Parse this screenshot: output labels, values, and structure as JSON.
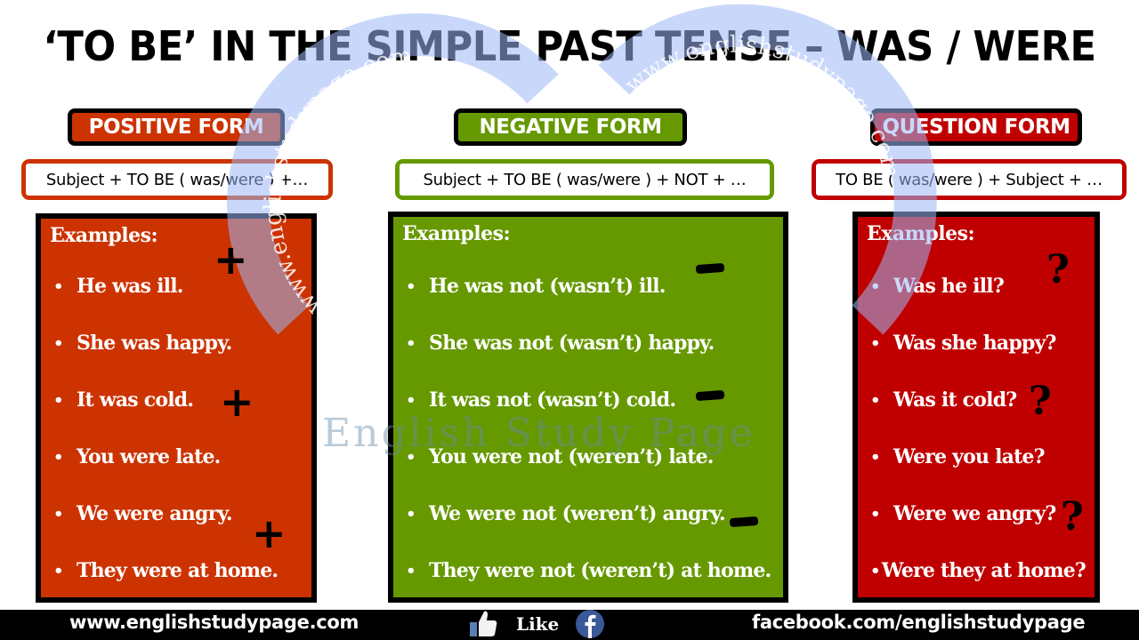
{
  "title": "‘TO BE’ IN THE SIMPLE PAST TENSE – WAS / WERE",
  "watermark": {
    "arc_left": "www.englishstudypage.com",
    "arc_right": "www.englishstudypage.com",
    "center": "English Study Page"
  },
  "colors": {
    "positive": "#cc3300",
    "negative": "#669900",
    "question": "#c00000",
    "watermark": "#9db8f5"
  },
  "columns": [
    {
      "id": "positive",
      "label": "POSITIVE FORM",
      "pattern": "Subject + TO BE ( was/were ) +…",
      "heading": "Examples:",
      "examples": [
        "He was ill.",
        "She was happy.",
        "It was cold.",
        "You were late.",
        "We were angry.",
        "They were at home."
      ],
      "mark_icon": "plus-icon",
      "mark_glyph": "+"
    },
    {
      "id": "negative",
      "label": "NEGATIVE FORM",
      "pattern": "Subject + TO BE ( was/were ) + NOT + …",
      "heading": "Examples:",
      "examples": [
        "He was not (wasn’t) ill.",
        "She was not (wasn’t) happy.",
        "It was not (wasn’t) cold.",
        "You were not (weren’t) late.",
        "We were not (weren’t) angry.",
        "They were not (weren’t) at home."
      ],
      "mark_icon": "minus-icon",
      "mark_glyph": "–"
    },
    {
      "id": "question",
      "label": "QUESTION FORM",
      "pattern": "TO BE ( was/were ) + Subject + …",
      "heading": "Examples:",
      "examples": [
        "Was he ill?",
        "Was she happy?",
        "Was it cold?",
        "Were you late?",
        "Were we angry?",
        "Were they at home?"
      ],
      "mark_icon": "question-mark-icon",
      "mark_glyph": "?"
    }
  ],
  "footer": {
    "website": "www.englishstudypage.com",
    "like_label": "Like",
    "like_icon": "thumbs-up-icon",
    "facebook_icon": "facebook-icon",
    "facebook": "facebook.com/englishstudypage"
  }
}
